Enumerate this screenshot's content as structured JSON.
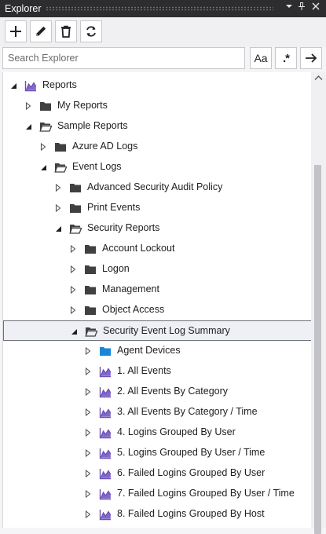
{
  "window": {
    "title": "Explorer",
    "title_controls": [
      {
        "name": "dropdown-icon",
        "glyph": "▾"
      },
      {
        "name": "pin-icon",
        "glyph": "⊥"
      },
      {
        "name": "close-icon",
        "glyph": "✕"
      }
    ]
  },
  "toolbar": {
    "buttons": [
      {
        "name": "add-button",
        "icon": "plus-icon"
      },
      {
        "name": "edit-button",
        "icon": "pencil-icon"
      },
      {
        "name": "delete-button",
        "icon": "trash-icon"
      },
      {
        "name": "refresh-button",
        "icon": "refresh-icon"
      }
    ]
  },
  "search": {
    "placeholder": "Search Explorer",
    "value": "",
    "match_case_label": "Aa",
    "regex_label": ".*",
    "go_icon": "arrow-right-icon"
  },
  "colors": {
    "folder": "#404040",
    "folder_blue": "#1a86d9",
    "report": "#6b4fbb",
    "selected_border": "#6e7079"
  },
  "tree": {
    "items": [
      {
        "label": "Reports",
        "level": 0,
        "state": "expanded",
        "icon": "report"
      },
      {
        "label": "My Reports",
        "level": 1,
        "state": "collapsed",
        "icon": "folder"
      },
      {
        "label": "Sample Reports",
        "level": 1,
        "state": "expanded",
        "icon": "folder-open"
      },
      {
        "label": "Azure AD Logs",
        "level": 2,
        "state": "collapsed",
        "icon": "folder"
      },
      {
        "label": "Event Logs",
        "level": 2,
        "state": "expanded",
        "icon": "folder-open"
      },
      {
        "label": "Advanced Security Audit Policy",
        "level": 3,
        "state": "collapsed",
        "icon": "folder"
      },
      {
        "label": "Print Events",
        "level": 3,
        "state": "collapsed",
        "icon": "folder"
      },
      {
        "label": "Security Reports",
        "level": 3,
        "state": "expanded",
        "icon": "folder-open"
      },
      {
        "label": "Account Lockout",
        "level": 4,
        "state": "collapsed",
        "icon": "folder"
      },
      {
        "label": "Logon",
        "level": 4,
        "state": "collapsed",
        "icon": "folder"
      },
      {
        "label": "Management",
        "level": 4,
        "state": "collapsed",
        "icon": "folder"
      },
      {
        "label": "Object Access",
        "level": 4,
        "state": "collapsed",
        "icon": "folder"
      },
      {
        "label": "Security Event Log Summary",
        "level": 4,
        "state": "expanded",
        "icon": "folder-open",
        "selected": true
      },
      {
        "label": "Agent Devices",
        "level": 5,
        "state": "collapsed",
        "icon": "folder-blue"
      },
      {
        "label": "1. All Events",
        "level": 5,
        "state": "collapsed",
        "icon": "report"
      },
      {
        "label": "2. All Events By Category",
        "level": 5,
        "state": "collapsed",
        "icon": "report"
      },
      {
        "label": "3. All Events By Category / Time",
        "level": 5,
        "state": "collapsed",
        "icon": "report"
      },
      {
        "label": "4. Logins Grouped By User",
        "level": 5,
        "state": "collapsed",
        "icon": "report"
      },
      {
        "label": "5. Logins Grouped By User / Time",
        "level": 5,
        "state": "collapsed",
        "icon": "report"
      },
      {
        "label": "6. Failed Logins Grouped By User",
        "level": 5,
        "state": "collapsed",
        "icon": "report"
      },
      {
        "label": "7. Failed Logins Grouped By User / Time",
        "level": 5,
        "state": "collapsed",
        "icon": "report"
      },
      {
        "label": "8. Failed Logins Grouped By Host",
        "level": 5,
        "state": "collapsed",
        "icon": "report"
      }
    ]
  }
}
